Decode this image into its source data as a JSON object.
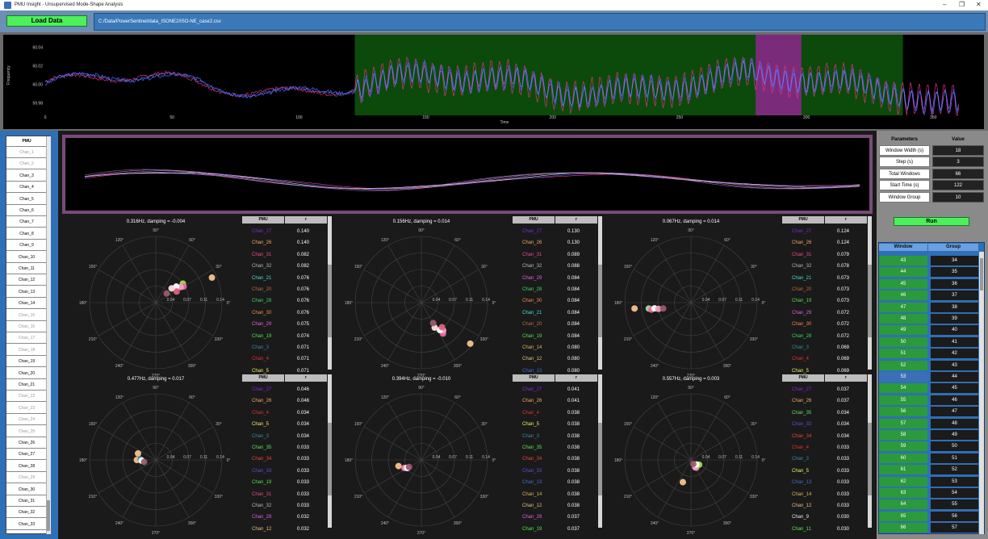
{
  "window": {
    "title": "PMU Insight - Unsupervised Mode-Shape Analysis"
  },
  "toolbar": {
    "load_label": "Load Data",
    "file_path": "C:/Data/PowerSentinel/data_ISONE2/ISO-NE_case2.csv"
  },
  "timeseries": {
    "ylabel": "Frequency",
    "xlabel": "Time",
    "yticks": [
      "60.04",
      "60.02",
      "60.00",
      "59.98"
    ],
    "xticks": [
      "0",
      "50",
      "100",
      "150",
      "200",
      "250",
      "300",
      "350"
    ],
    "xlim": [
      0,
      362
    ],
    "ylim": [
      59.97,
      60.05
    ],
    "highlight_range": [
      122,
      338
    ],
    "window_range": [
      280,
      298
    ],
    "colors": {
      "green": "#0b4a0b",
      "purple": "#7a2c7a"
    }
  },
  "pmu_list": {
    "header": "PMU",
    "items": [
      {
        "label": "Chan_1",
        "active": false
      },
      {
        "label": "Chan_2",
        "active": false
      },
      {
        "label": "Chan_3",
        "active": true
      },
      {
        "label": "Chan_4",
        "active": true
      },
      {
        "label": "Chan_5",
        "active": true
      },
      {
        "label": "Chan_6",
        "active": true
      },
      {
        "label": "Chan_7",
        "active": true
      },
      {
        "label": "Chan_8",
        "active": true
      },
      {
        "label": "Chan_9",
        "active": true
      },
      {
        "label": "Chan_10",
        "active": true
      },
      {
        "label": "Chan_11",
        "active": true
      },
      {
        "label": "Chan_12",
        "active": true
      },
      {
        "label": "Chan_13",
        "active": true
      },
      {
        "label": "Chan_14",
        "active": true
      },
      {
        "label": "Chan_15",
        "active": false
      },
      {
        "label": "Chan_16",
        "active": false
      },
      {
        "label": "Chan_17",
        "active": false
      },
      {
        "label": "Chan_18",
        "active": false
      },
      {
        "label": "Chan_19",
        "active": true
      },
      {
        "label": "Chan_20",
        "active": true
      },
      {
        "label": "Chan_21",
        "active": true
      },
      {
        "label": "Chan_22",
        "active": false
      },
      {
        "label": "Chan_23",
        "active": false
      },
      {
        "label": "Chan_24",
        "active": false
      },
      {
        "label": "Chan_25",
        "active": false
      },
      {
        "label": "Chan_26",
        "active": true
      },
      {
        "label": "Chan_27",
        "active": true
      },
      {
        "label": "Chan_28",
        "active": true
      },
      {
        "label": "Chan_29",
        "active": false
      },
      {
        "label": "Chan_30",
        "active": true
      },
      {
        "label": "Chan_31",
        "active": true
      },
      {
        "label": "Chan_32",
        "active": true
      },
      {
        "label": "Chan_33",
        "active": true
      }
    ]
  },
  "parameters": {
    "header_label": "Parameters",
    "header_value": "Value",
    "rows": [
      {
        "label": "Window Width (s)",
        "value": "18"
      },
      {
        "label": "Step (s)",
        "value": "3"
      },
      {
        "label": "Total Windows",
        "value": "66"
      },
      {
        "label": "Start Time (s)",
        "value": "122"
      },
      {
        "label": "Window Group",
        "value": "10"
      }
    ],
    "run_label": "Run"
  },
  "window_group": {
    "header_window": "Window",
    "header_group": "Group",
    "rows": [
      {
        "w": "43",
        "g": "34"
      },
      {
        "w": "44",
        "g": "35"
      },
      {
        "w": "45",
        "g": "36"
      },
      {
        "w": "46",
        "g": "37"
      },
      {
        "w": "47",
        "g": "38"
      },
      {
        "w": "48",
        "g": "39"
      },
      {
        "w": "49",
        "g": "40"
      },
      {
        "w": "50",
        "g": "41"
      },
      {
        "w": "51",
        "g": "42"
      },
      {
        "w": "52",
        "g": "43"
      },
      {
        "w": "53",
        "g": "44"
      },
      {
        "w": "54",
        "g": "45"
      },
      {
        "w": "55",
        "g": "46"
      },
      {
        "w": "56",
        "g": "47"
      },
      {
        "w": "57",
        "g": "48"
      },
      {
        "w": "58",
        "g": "49"
      },
      {
        "w": "59",
        "g": "50"
      },
      {
        "w": "60",
        "g": "51"
      },
      {
        "w": "61",
        "g": "52"
      },
      {
        "w": "62",
        "g": "53"
      },
      {
        "w": "63",
        "g": "54"
      },
      {
        "w": "64",
        "g": "55"
      },
      {
        "w": "65",
        "g": "56"
      },
      {
        "w": "66",
        "g": "57"
      }
    ],
    "selected": "53"
  },
  "polar": {
    "angle_labels": [
      "90°",
      "60°",
      "30°",
      "0°",
      "330°",
      "300°",
      "270°",
      "240°",
      "210°",
      "180°",
      "150°",
      "120°"
    ],
    "radial_labels": [
      "0.04",
      "0.07",
      "0.11",
      "0.14"
    ],
    "rmax": 0.14
  },
  "channel_colors": {
    "Chan_27": "#7a2ad6",
    "Chan_26": "#f0a860",
    "Chan_31": "#e84a8a",
    "Chan_32": "#b8b8b8",
    "Chan_21": "#40e0d0",
    "Chan_20": "#b86a3a",
    "Chan_28": "#3ad66a",
    "Chan_30": "#f08a50",
    "Chan_29": "#e060e0",
    "Chan_19": "#50e050",
    "Chan_3": "#3a8aa0",
    "Chan_4": "#e03030",
    "Chan_5": "#f0f060",
    "Chan_35": "#5ae05a",
    "Chan_34": "#e04a30",
    "Chan_33": "#6a4ad0",
    "Chan_12": "#e0c080",
    "Chan_14": "#e0b060",
    "Chan_13": "#4a6ad0",
    "Chan_9": "#e8e8e8",
    "Chan_11": "#60e060"
  },
  "modes": [
    {
      "title": "0.316Hz, damping = -0.004",
      "col_name": "PMU",
      "col_r": "r",
      "table": [
        [
          "Chan_27",
          "0.140"
        ],
        [
          "Chan_26",
          "0.140"
        ],
        [
          "Chan_31",
          "0.082"
        ],
        [
          "Chan_32",
          "0.082"
        ],
        [
          "Chan_21",
          "0.076"
        ],
        [
          "Chan_20",
          "0.076"
        ],
        [
          "Chan_28",
          "0.076"
        ],
        [
          "Chan_30",
          "0.076"
        ],
        [
          "Chan_29",
          "0.075"
        ],
        [
          "Chan_19",
          "0.074"
        ],
        [
          "Chan_3",
          "0.071"
        ],
        [
          "Chan_4",
          "0.071"
        ],
        [
          "Chan_5",
          "0.071"
        ]
      ],
      "points": [
        {
          "mag": 0.13,
          "ang": 24,
          "color": "#f6c48a"
        },
        {
          "mag": 0.07,
          "ang": 35,
          "color": "#a0e040"
        },
        {
          "mag": 0.068,
          "ang": 30,
          "color": "#e86aa0"
        },
        {
          "mag": 0.062,
          "ang": 32,
          "color": "#f0a0c0"
        },
        {
          "mag": 0.055,
          "ang": 38,
          "color": "#ffffff"
        },
        {
          "mag": 0.05,
          "ang": 28,
          "color": "#e06080"
        },
        {
          "mag": 0.045,
          "ang": 42,
          "color": "#ffe0e0"
        },
        {
          "mag": 0.03,
          "ang": 40,
          "color": "#9a5a70"
        }
      ]
    },
    {
      "title": "0.156Hz, damping = 0.014",
      "col_name": "PMU",
      "col_r": "r",
      "table": [
        [
          "Chan_27",
          "0.130"
        ],
        [
          "Chan_26",
          "0.130"
        ],
        [
          "Chan_31",
          "0.089"
        ],
        [
          "Chan_32",
          "0.088"
        ],
        [
          "Chan_29",
          "0.084"
        ],
        [
          "Chan_28",
          "0.084"
        ],
        [
          "Chan_30",
          "0.084"
        ],
        [
          "Chan_21",
          "0.084"
        ],
        [
          "Chan_20",
          "0.084"
        ],
        [
          "Chan_19",
          "0.084"
        ],
        [
          "Chan_14",
          "0.080"
        ],
        [
          "Chan_12",
          "0.080"
        ],
        [
          "Chan_13",
          "0.080"
        ]
      ],
      "points": [
        {
          "mag": 0.135,
          "ang": -40,
          "color": "#f6c48a"
        },
        {
          "mag": 0.08,
          "ang": -55,
          "color": "#e86aa0"
        },
        {
          "mag": 0.075,
          "ang": -52,
          "color": "#f0a0c0"
        },
        {
          "mag": 0.07,
          "ang": -56,
          "color": "#ffffff"
        },
        {
          "mag": 0.068,
          "ang": -50,
          "color": "#e06080"
        },
        {
          "mag": 0.06,
          "ang": -62,
          "color": "#ffe0e0"
        },
        {
          "mag": 0.05,
          "ang": -60,
          "color": "#9a5a70"
        }
      ]
    },
    {
      "title": "0.067Hz, damping = 0.014",
      "col_name": "PMU",
      "col_r": "r",
      "table": [
        [
          "Chan_27",
          "0.124"
        ],
        [
          "Chan_26",
          "0.124"
        ],
        [
          "Chan_31",
          "0.079"
        ],
        [
          "Chan_32",
          "0.078"
        ],
        [
          "Chan_21",
          "0.073"
        ],
        [
          "Chan_20",
          "0.073"
        ],
        [
          "Chan_19",
          "0.073"
        ],
        [
          "Chan_29",
          "0.072"
        ],
        [
          "Chan_30",
          "0.072"
        ],
        [
          "Chan_28",
          "0.072"
        ],
        [
          "Chan_3",
          "0.069"
        ],
        [
          "Chan_4",
          "0.069"
        ],
        [
          "Chan_5",
          "0.069"
        ]
      ],
      "points": [
        {
          "mag": 0.12,
          "ang": 186,
          "color": "#f6c48a"
        },
        {
          "mag": 0.09,
          "ang": 188,
          "color": "#9ae0a0"
        },
        {
          "mag": 0.085,
          "ang": 190,
          "color": "#e86aa0"
        },
        {
          "mag": 0.078,
          "ang": 189,
          "color": "#ffffff"
        },
        {
          "mag": 0.07,
          "ang": 191,
          "color": "#f0a0c0"
        },
        {
          "mag": 0.06,
          "ang": 192,
          "color": "#9a5a70"
        }
      ]
    },
    {
      "title": "0.477Hz, damping = 0.017",
      "col_name": "PMU",
      "col_r": "r",
      "table": [
        [
          "Chan_27",
          "0.046"
        ],
        [
          "Chan_26",
          "0.046"
        ],
        [
          "Chan_4",
          "0.034"
        ],
        [
          "Chan_5",
          "0.034"
        ],
        [
          "Chan_3",
          "0.034"
        ],
        [
          "Chan_35",
          "0.033"
        ],
        [
          "Chan_34",
          "0.033"
        ],
        [
          "Chan_33",
          "0.033"
        ],
        [
          "Chan_19",
          "0.033"
        ],
        [
          "Chan_31",
          "0.033"
        ],
        [
          "Chan_32",
          "0.033"
        ],
        [
          "Chan_29",
          "0.032"
        ],
        [
          "Chan_12",
          "0.032"
        ]
      ],
      "points": [
        {
          "mag": 0.04,
          "ang": 160,
          "color": "#f6c48a"
        },
        {
          "mag": 0.04,
          "ang": 180,
          "color": "#f6c48a"
        },
        {
          "mag": 0.032,
          "ang": 178,
          "color": "#3a8aa0"
        },
        {
          "mag": 0.03,
          "ang": 183,
          "color": "#ffffff"
        },
        {
          "mag": 0.025,
          "ang": 190,
          "color": "#9a5a70"
        }
      ]
    },
    {
      "title": "0.394Hz, damping = -0.010",
      "col_name": "PMU",
      "col_r": "r",
      "table": [
        [
          "Chan_27",
          "0.041"
        ],
        [
          "Chan_26",
          "0.041"
        ],
        [
          "Chan_4",
          "0.038"
        ],
        [
          "Chan_5",
          "0.038"
        ],
        [
          "Chan_3",
          "0.038"
        ],
        [
          "Chan_35",
          "0.038"
        ],
        [
          "Chan_34",
          "0.038"
        ],
        [
          "Chan_33",
          "0.038"
        ],
        [
          "Chan_13",
          "0.038"
        ],
        [
          "Chan_14",
          "0.038"
        ],
        [
          "Chan_12",
          "0.038"
        ],
        [
          "Chan_29",
          "0.037"
        ],
        [
          "Chan_19",
          "0.037"
        ]
      ],
      "points": [
        {
          "mag": 0.05,
          "ang": 195,
          "color": "#f6c48a"
        },
        {
          "mag": 0.04,
          "ang": 205,
          "color": "#e86aa0"
        },
        {
          "mag": 0.037,
          "ang": 207,
          "color": "#f0a0c0"
        },
        {
          "mag": 0.034,
          "ang": 210,
          "color": "#ffffff"
        },
        {
          "mag": 0.03,
          "ang": 210,
          "color": "#9a5a70"
        }
      ]
    },
    {
      "title": "0.557Hz, damping = 0.003",
      "col_name": "PMU",
      "col_r": "r",
      "table": [
        [
          "Chan_27",
          "0.037"
        ],
        [
          "Chan_26",
          "0.037"
        ],
        [
          "Chan_35",
          "0.034"
        ],
        [
          "Chan_33",
          "0.034"
        ],
        [
          "Chan_34",
          "0.034"
        ],
        [
          "Chan_4",
          "0.033"
        ],
        [
          "Chan_3",
          "0.033"
        ],
        [
          "Chan_5",
          "0.033"
        ],
        [
          "Chan_13",
          "0.033"
        ],
        [
          "Chan_14",
          "0.033"
        ],
        [
          "Chan_12",
          "0.033"
        ],
        [
          "Chan_9",
          "0.030"
        ],
        [
          "Chan_11",
          "0.030"
        ]
      ],
      "points": [
        {
          "mag": 0.05,
          "ang": 250,
          "color": "#f6c48a"
        },
        {
          "mag": 0.02,
          "ang": 305,
          "color": "#e86aa0"
        },
        {
          "mag": 0.018,
          "ang": 300,
          "color": "#f0a0c0"
        },
        {
          "mag": 0.02,
          "ang": 330,
          "color": "#a0e040"
        },
        {
          "mag": 0.015,
          "ang": 320,
          "color": "#ffffff"
        },
        {
          "mag": 0.01,
          "ang": 300,
          "color": "#9a5a70"
        }
      ]
    }
  ]
}
